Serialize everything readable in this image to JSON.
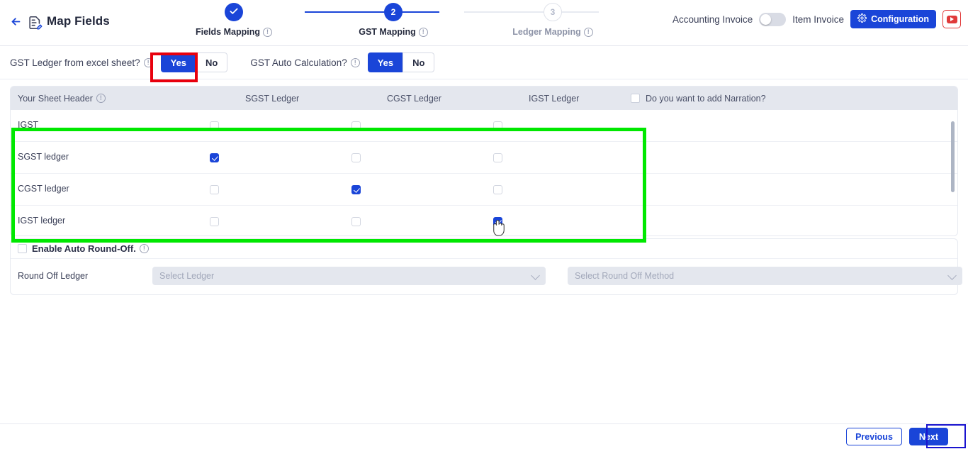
{
  "header": {
    "back_icon": "arrow-left-icon",
    "doc_icon": "document-edit-icon",
    "title": "Map Fields"
  },
  "stepper": {
    "steps": [
      {
        "number": "1",
        "label": "Fields Mapping",
        "state": "done",
        "mark": "✓"
      },
      {
        "number": "2",
        "label": "GST Mapping",
        "state": "active",
        "mark": "2"
      },
      {
        "number": "3",
        "label": "Ledger Mapping",
        "state": "todo",
        "mark": "3"
      }
    ]
  },
  "topright": {
    "accounting_invoice_label": "Accounting Invoice",
    "toggle_state": "off",
    "item_invoice_label": "Item Invoice",
    "configuration_label": "Configuration",
    "configuration_icon": "gear-icon",
    "youtube_icon": "youtube-icon"
  },
  "options": {
    "gst_ledger_question": "GST Ledger from excel sheet?",
    "gst_ledger_yes": "Yes",
    "gst_ledger_no": "No",
    "gst_ledger_selected": "Yes",
    "gst_auto_question": "GST Auto Calculation?",
    "gst_auto_yes": "Yes",
    "gst_auto_no": "No",
    "gst_auto_selected": "Yes"
  },
  "table": {
    "columns": [
      {
        "label": "Your Sheet Header",
        "has_info": true
      },
      {
        "label": "SGST Ledger",
        "has_info": false
      },
      {
        "label": "CGST Ledger",
        "has_info": false
      },
      {
        "label": "IGST Ledger",
        "has_info": false
      }
    ],
    "narration_label": "Do you want to add Narration?",
    "narration_checked": false,
    "rows": [
      {
        "label": "IGST",
        "sgst": false,
        "cgst": false,
        "igst": false
      },
      {
        "label": "SGST ledger",
        "sgst": true,
        "cgst": false,
        "igst": false
      },
      {
        "label": "CGST ledger",
        "sgst": false,
        "cgst": true,
        "igst": false
      },
      {
        "label": "IGST ledger",
        "sgst": false,
        "cgst": false,
        "igst": true
      }
    ]
  },
  "roundoff": {
    "enable_label": "Enable Auto Round-Off.",
    "enable_checked": false,
    "ledger_label": "Round Off Ledger",
    "ledger_placeholder": "Select Ledger",
    "ledger_value": "",
    "method_placeholder": "Select Round Off Method",
    "method_value": ""
  },
  "footer": {
    "previous_label": "Previous",
    "next_label": "Next"
  },
  "colors": {
    "accent": "#1a45d8",
    "annotation_red": "#e8000d",
    "annotation_green": "#00e800",
    "annotation_blue": "#1a14cf",
    "header_bg": "#e4e7ee"
  }
}
